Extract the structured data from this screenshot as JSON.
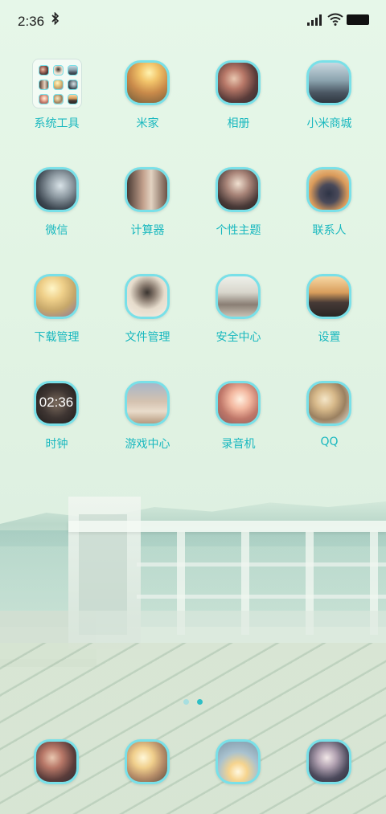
{
  "status_bar": {
    "time": "2:36",
    "bluetooth_icon": "bluetooth-icon",
    "signal_icon": "signal-icon",
    "wifi_icon": "wifi-icon",
    "battery_icon": "battery-icon"
  },
  "apps": [
    {
      "name": "app-system-tools",
      "label": "系统工具",
      "kind": "folder"
    },
    {
      "name": "app-mi-home",
      "label": "米家",
      "photo": "sunset-field"
    },
    {
      "name": "app-gallery",
      "label": "相册",
      "photo": "couple-hug"
    },
    {
      "name": "app-mi-store",
      "label": "小米商城",
      "photo": "couple-sea"
    },
    {
      "name": "app-wechat",
      "label": "微信",
      "photo": "couple-close"
    },
    {
      "name": "app-calculator",
      "label": "计算器",
      "photo": "couple-kiss"
    },
    {
      "name": "app-themes",
      "label": "个性主题",
      "photo": "couple-embrace"
    },
    {
      "name": "app-contacts",
      "label": "联系人",
      "photo": "man-sunset"
    },
    {
      "name": "app-downloads",
      "label": "下载管理",
      "photo": "girl-sunlight"
    },
    {
      "name": "app-file-manager",
      "label": "文件管理",
      "photo": "girl-wind"
    },
    {
      "name": "app-security",
      "label": "安全中心",
      "photo": "girl-beach"
    },
    {
      "name": "app-settings",
      "label": "设置",
      "photo": "couple-sitting"
    },
    {
      "name": "app-clock",
      "label": "时钟",
      "photo": "clock",
      "clock_time": "02:36"
    },
    {
      "name": "app-game-center",
      "label": "游戏中心",
      "photo": "girl-lake"
    },
    {
      "name": "app-recorder",
      "label": "录音机",
      "photo": "couple-glow"
    },
    {
      "name": "app-qq",
      "label": "QQ",
      "photo": "girl-blonde"
    }
  ],
  "dock": [
    {
      "name": "dock-phone",
      "label": "",
      "photo": "couple-hug"
    },
    {
      "name": "dock-messages",
      "label": "",
      "photo": "couple-sun"
    },
    {
      "name": "dock-browser",
      "label": "",
      "photo": "couple-running"
    },
    {
      "name": "dock-camera",
      "label": "",
      "photo": "couple-field"
    }
  ],
  "page_indicator": {
    "pages": 2,
    "current": 2
  },
  "colors": {
    "label": "#19b8bf",
    "icon_border": "#79e0e8",
    "dot_active": "#2fbfc6",
    "dot_inactive": "#a8dfe0"
  }
}
